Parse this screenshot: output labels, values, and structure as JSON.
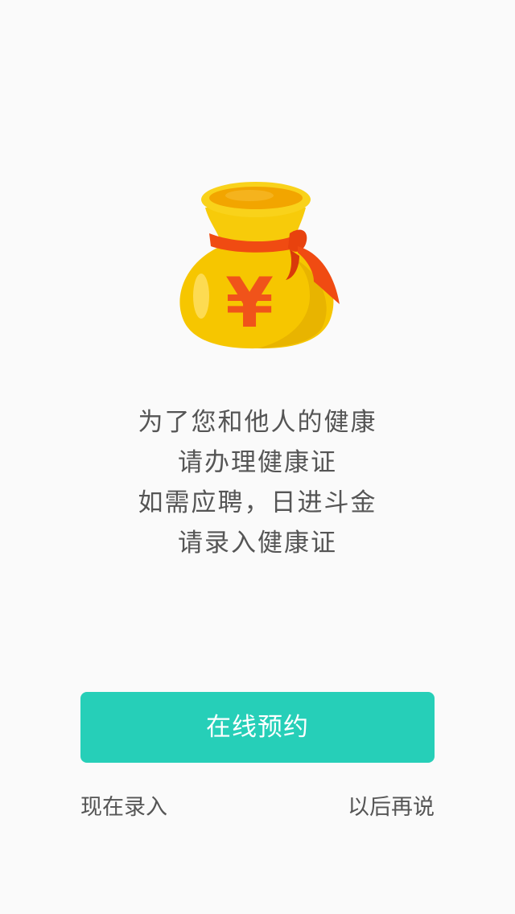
{
  "illustration": {
    "icon": "money-bag-icon",
    "symbol": "¥",
    "colors": {
      "bag": "#f6c600",
      "bag_shadow": "#e0a800",
      "rim": "#f2a500",
      "ribbon": "#f04b12",
      "symbol": "#f0531a"
    }
  },
  "message": {
    "lines": [
      "为了您和他人的健康",
      "请办理健康证",
      "如需应聘，日进斗金",
      "请录入健康证"
    ]
  },
  "actions": {
    "primary_label": "在线预约",
    "enter_now_label": "现在录入",
    "later_label": "以后再说"
  },
  "colors": {
    "accent": "#26cfb8",
    "background": "#fafafa",
    "text": "#555555"
  }
}
